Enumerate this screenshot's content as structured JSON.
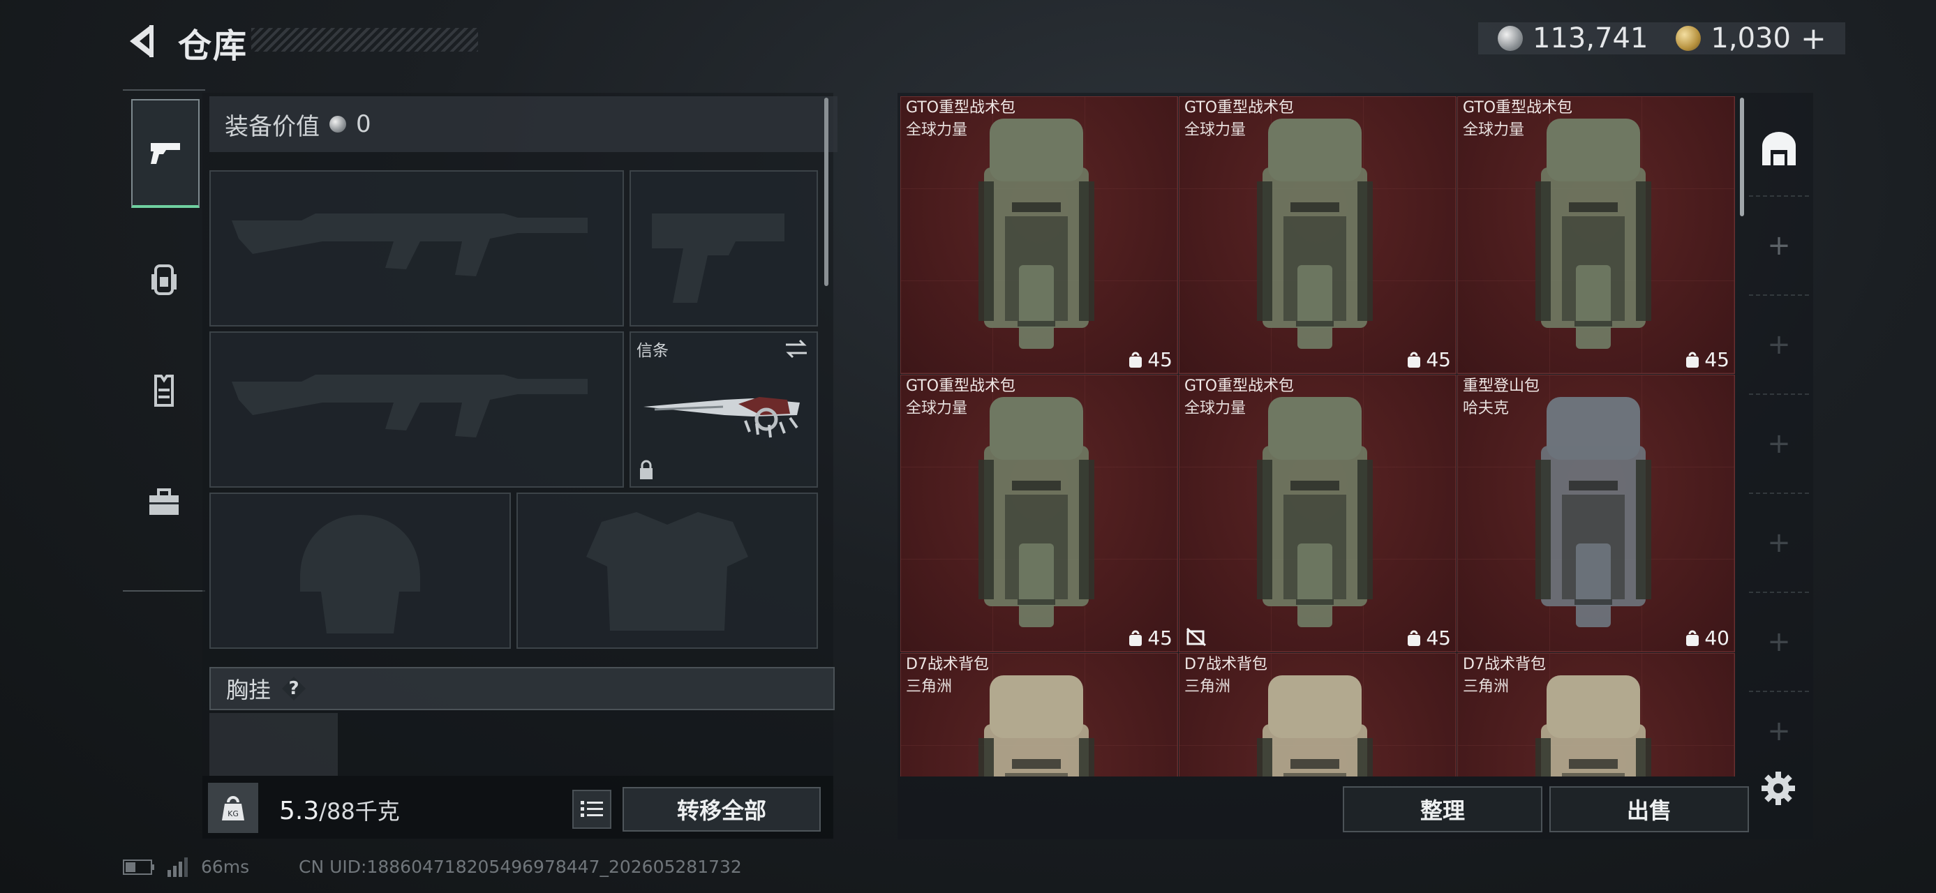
{
  "header": {
    "title": "仓库"
  },
  "currency": {
    "silver": "113,741",
    "gold": "1,030",
    "add_symbol": "+"
  },
  "sidebar": {
    "items": [
      {
        "name": "weapons",
        "icon": "pistol-icon",
        "active": true
      },
      {
        "name": "backpack",
        "icon": "backpack-icon",
        "active": false
      },
      {
        "name": "vest",
        "icon": "vest-icon",
        "active": false
      },
      {
        "name": "toolbox",
        "icon": "toolbox-icon",
        "active": false
      }
    ]
  },
  "loadout": {
    "value_label": "装备价值",
    "value": "0",
    "melee_label": "信条",
    "chest_label": "胸挂",
    "chest_help": "?"
  },
  "weight": {
    "current": "5.3",
    "max": "/88千克",
    "icon_text": "KG"
  },
  "buttons": {
    "transfer_all": "转移全部",
    "sort": "整理",
    "sell": "出售"
  },
  "status": {
    "ping": "66ms",
    "uid": "CN UID:1886047182054969784​47_202605281732"
  },
  "inventory": {
    "items": [
      {
        "name": "GTO重型战术包",
        "brand": "全球力量",
        "capacity": "45",
        "color": "#6f7862",
        "icon": "bag-capacity-icon"
      },
      {
        "name": "GTO重型战术包",
        "brand": "全球力量",
        "capacity": "45",
        "color": "#6f7862",
        "icon": "bag-capacity-icon"
      },
      {
        "name": "GTO重型战术包",
        "brand": "全球力量",
        "capacity": "45",
        "color": "#6f7862",
        "icon": "bag-capacity-icon"
      },
      {
        "name": "GTO重型战术包",
        "brand": "全球力量",
        "capacity": "45",
        "color": "#6f7862",
        "icon": "bag-capacity-icon"
      },
      {
        "name": "GTO重型战术包",
        "brand": "全球力量",
        "capacity": "45",
        "color": "#6f7862",
        "icon": "bag-capacity-icon",
        "no_insure": true
      },
      {
        "name": "重型登山包",
        "brand": "哈夫克",
        "capacity": "40",
        "color": "#6d737b",
        "icon": "bag-capacity-icon"
      },
      {
        "name": "D7战术背包",
        "brand": "三角洲",
        "capacity": "",
        "color": "#b2a98f",
        "icon": "bag-capacity-icon"
      },
      {
        "name": "D7战术背包",
        "brand": "三角洲",
        "capacity": "",
        "color": "#b2a98f",
        "icon": "bag-capacity-icon"
      },
      {
        "name": "D7战术背包",
        "brand": "三角洲",
        "capacity": "",
        "color": "#b2a98f",
        "icon": "bag-capacity-icon"
      }
    ]
  },
  "right_tabs": {
    "plus": "+"
  }
}
